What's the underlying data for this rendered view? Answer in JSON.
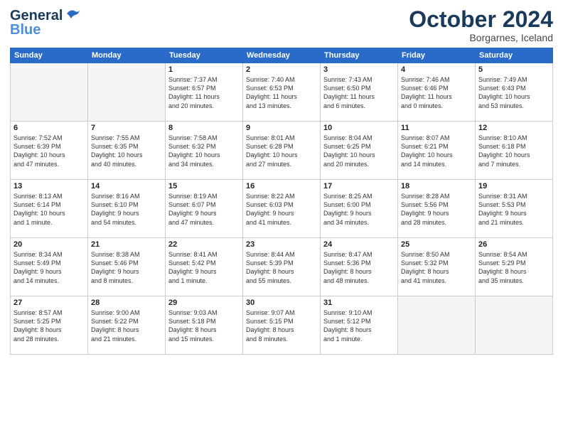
{
  "header": {
    "logo_line1": "General",
    "logo_line2": "Blue",
    "month": "October 2024",
    "location": "Borgarnes, Iceland"
  },
  "weekdays": [
    "Sunday",
    "Monday",
    "Tuesday",
    "Wednesday",
    "Thursday",
    "Friday",
    "Saturday"
  ],
  "weeks": [
    [
      {
        "day": "",
        "info": ""
      },
      {
        "day": "",
        "info": ""
      },
      {
        "day": "1",
        "info": "Sunrise: 7:37 AM\nSunset: 6:57 PM\nDaylight: 11 hours\nand 20 minutes."
      },
      {
        "day": "2",
        "info": "Sunrise: 7:40 AM\nSunset: 6:53 PM\nDaylight: 11 hours\nand 13 minutes."
      },
      {
        "day": "3",
        "info": "Sunrise: 7:43 AM\nSunset: 6:50 PM\nDaylight: 11 hours\nand 6 minutes."
      },
      {
        "day": "4",
        "info": "Sunrise: 7:46 AM\nSunset: 6:46 PM\nDaylight: 11 hours\nand 0 minutes."
      },
      {
        "day": "5",
        "info": "Sunrise: 7:49 AM\nSunset: 6:43 PM\nDaylight: 10 hours\nand 53 minutes."
      }
    ],
    [
      {
        "day": "6",
        "info": "Sunrise: 7:52 AM\nSunset: 6:39 PM\nDaylight: 10 hours\nand 47 minutes."
      },
      {
        "day": "7",
        "info": "Sunrise: 7:55 AM\nSunset: 6:35 PM\nDaylight: 10 hours\nand 40 minutes."
      },
      {
        "day": "8",
        "info": "Sunrise: 7:58 AM\nSunset: 6:32 PM\nDaylight: 10 hours\nand 34 minutes."
      },
      {
        "day": "9",
        "info": "Sunrise: 8:01 AM\nSunset: 6:28 PM\nDaylight: 10 hours\nand 27 minutes."
      },
      {
        "day": "10",
        "info": "Sunrise: 8:04 AM\nSunset: 6:25 PM\nDaylight: 10 hours\nand 20 minutes."
      },
      {
        "day": "11",
        "info": "Sunrise: 8:07 AM\nSunset: 6:21 PM\nDaylight: 10 hours\nand 14 minutes."
      },
      {
        "day": "12",
        "info": "Sunrise: 8:10 AM\nSunset: 6:18 PM\nDaylight: 10 hours\nand 7 minutes."
      }
    ],
    [
      {
        "day": "13",
        "info": "Sunrise: 8:13 AM\nSunset: 6:14 PM\nDaylight: 10 hours\nand 1 minute."
      },
      {
        "day": "14",
        "info": "Sunrise: 8:16 AM\nSunset: 6:10 PM\nDaylight: 9 hours\nand 54 minutes."
      },
      {
        "day": "15",
        "info": "Sunrise: 8:19 AM\nSunset: 6:07 PM\nDaylight: 9 hours\nand 47 minutes."
      },
      {
        "day": "16",
        "info": "Sunrise: 8:22 AM\nSunset: 6:03 PM\nDaylight: 9 hours\nand 41 minutes."
      },
      {
        "day": "17",
        "info": "Sunrise: 8:25 AM\nSunset: 6:00 PM\nDaylight: 9 hours\nand 34 minutes."
      },
      {
        "day": "18",
        "info": "Sunrise: 8:28 AM\nSunset: 5:56 PM\nDaylight: 9 hours\nand 28 minutes."
      },
      {
        "day": "19",
        "info": "Sunrise: 8:31 AM\nSunset: 5:53 PM\nDaylight: 9 hours\nand 21 minutes."
      }
    ],
    [
      {
        "day": "20",
        "info": "Sunrise: 8:34 AM\nSunset: 5:49 PM\nDaylight: 9 hours\nand 14 minutes."
      },
      {
        "day": "21",
        "info": "Sunrise: 8:38 AM\nSunset: 5:46 PM\nDaylight: 9 hours\nand 8 minutes."
      },
      {
        "day": "22",
        "info": "Sunrise: 8:41 AM\nSunset: 5:42 PM\nDaylight: 9 hours\nand 1 minute."
      },
      {
        "day": "23",
        "info": "Sunrise: 8:44 AM\nSunset: 5:39 PM\nDaylight: 8 hours\nand 55 minutes."
      },
      {
        "day": "24",
        "info": "Sunrise: 8:47 AM\nSunset: 5:36 PM\nDaylight: 8 hours\nand 48 minutes."
      },
      {
        "day": "25",
        "info": "Sunrise: 8:50 AM\nSunset: 5:32 PM\nDaylight: 8 hours\nand 41 minutes."
      },
      {
        "day": "26",
        "info": "Sunrise: 8:54 AM\nSunset: 5:29 PM\nDaylight: 8 hours\nand 35 minutes."
      }
    ],
    [
      {
        "day": "27",
        "info": "Sunrise: 8:57 AM\nSunset: 5:25 PM\nDaylight: 8 hours\nand 28 minutes."
      },
      {
        "day": "28",
        "info": "Sunrise: 9:00 AM\nSunset: 5:22 PM\nDaylight: 8 hours\nand 21 minutes."
      },
      {
        "day": "29",
        "info": "Sunrise: 9:03 AM\nSunset: 5:18 PM\nDaylight: 8 hours\nand 15 minutes."
      },
      {
        "day": "30",
        "info": "Sunrise: 9:07 AM\nSunset: 5:15 PM\nDaylight: 8 hours\nand 8 minutes."
      },
      {
        "day": "31",
        "info": "Sunrise: 9:10 AM\nSunset: 5:12 PM\nDaylight: 8 hours\nand 1 minute."
      },
      {
        "day": "",
        "info": ""
      },
      {
        "day": "",
        "info": ""
      }
    ]
  ]
}
